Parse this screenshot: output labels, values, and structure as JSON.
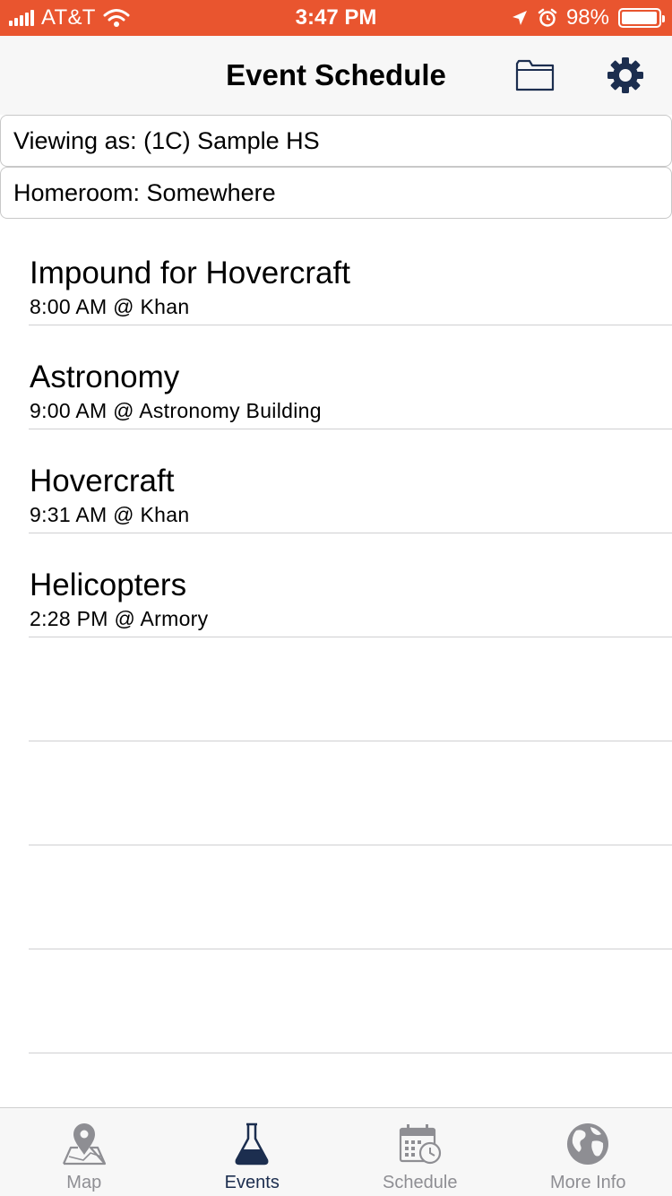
{
  "status_bar": {
    "carrier": "AT&T",
    "time": "3:47 PM",
    "battery_percent": "98%",
    "battery_level": 0.98
  },
  "nav": {
    "title": "Event Schedule",
    "folder_icon": "folder-icon",
    "settings_icon": "gear-icon",
    "accent_color": "#1c2e4f"
  },
  "info": {
    "viewing_as": "Viewing as: (1C) Sample HS",
    "homeroom": "Homeroom: Somewhere"
  },
  "events": [
    {
      "title": "Impound for Hovercraft",
      "detail": "8:00 AM @ Khan"
    },
    {
      "title": "Astronomy",
      "detail": "9:00 AM @ Astronomy Building"
    },
    {
      "title": "Hovercraft",
      "detail": "9:31 AM @ Khan"
    },
    {
      "title": "Helicopters",
      "detail": "2:28 PM @ Armory"
    },
    {
      "title": "",
      "detail": ""
    },
    {
      "title": "",
      "detail": ""
    },
    {
      "title": "",
      "detail": ""
    },
    {
      "title": "",
      "detail": ""
    }
  ],
  "tabs": [
    {
      "label": "Map",
      "icon": "map-pin-icon",
      "active": false
    },
    {
      "label": "Events",
      "icon": "flask-icon",
      "active": true
    },
    {
      "label": "Schedule",
      "icon": "calendar-clock-icon",
      "active": false
    },
    {
      "label": "More Info",
      "icon": "globe-icon",
      "active": false
    }
  ],
  "colors": {
    "status_bar": "#e9552f",
    "tab_inactive": "#8e8e93",
    "tab_active": "#1c2e4f"
  }
}
